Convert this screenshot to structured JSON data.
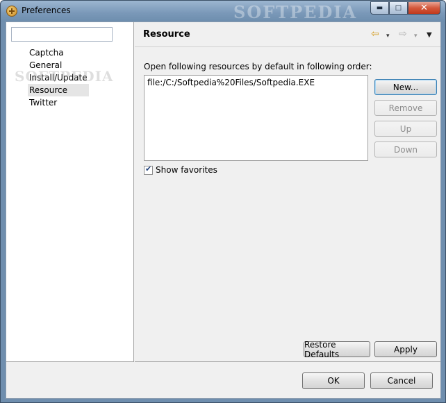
{
  "window": {
    "title": "Preferences",
    "watermark": "SOFTPEDIA",
    "minimize_label": "▬",
    "maximize_label": "□",
    "close_label": "✕"
  },
  "tree": {
    "filter_value": "",
    "items": [
      "Captcha",
      "General",
      "Install/Update",
      "Resource",
      "Twitter"
    ],
    "selected": "Resource",
    "watermark": "SOFTPEDIA"
  },
  "page": {
    "title": "Resource",
    "nav": {
      "back_icon": "⇦",
      "forward_icon": "⇨",
      "dropdown_glyph": "▾",
      "menu_glyph": "▼"
    },
    "description": "Open following resources by default in following order:",
    "resources": [
      "file:/C:/Softpedia%20Files/Softpedia.EXE"
    ],
    "buttons": {
      "new": "New...",
      "remove": "Remove",
      "up": "Up",
      "down": "Down"
    },
    "show_favorites_label": "Show favorites",
    "show_favorites_checked": true,
    "restore_defaults": "Restore Defaults",
    "apply": "Apply"
  },
  "dialog": {
    "ok": "OK",
    "cancel": "Cancel"
  },
  "colors": {
    "frame": "#6f8eae",
    "client": "#f0f0f0",
    "selection": "#e5e5e5",
    "back_arrow": "#d49a1c"
  }
}
